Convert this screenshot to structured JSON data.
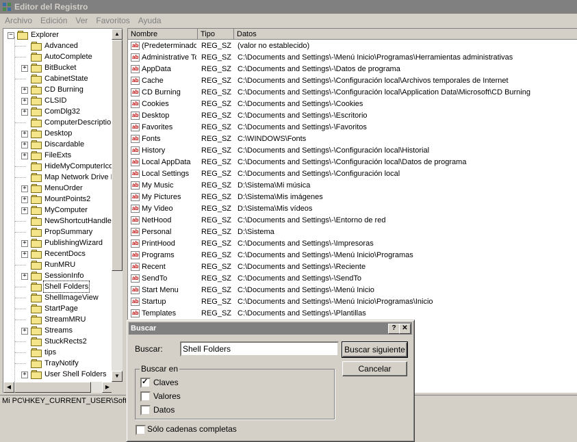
{
  "window": {
    "title": "Editor del Registro"
  },
  "menu": [
    "Archivo",
    "Edición",
    "Ver",
    "Favoritos",
    "Ayuda"
  ],
  "tree": {
    "items": [
      {
        "label": "Explorer",
        "expander": "−",
        "level": 0
      },
      {
        "label": "Advanced",
        "expander": "",
        "level": 1
      },
      {
        "label": "AutoComplete",
        "expander": "",
        "level": 1
      },
      {
        "label": "BitBucket",
        "expander": "+",
        "level": 1
      },
      {
        "label": "CabinetState",
        "expander": "",
        "level": 1
      },
      {
        "label": "CD Burning",
        "expander": "+",
        "level": 1
      },
      {
        "label": "CLSID",
        "expander": "+",
        "level": 1
      },
      {
        "label": "ComDlg32",
        "expander": "+",
        "level": 1
      },
      {
        "label": "ComputerDescriptions",
        "expander": "",
        "level": 1
      },
      {
        "label": "Desktop",
        "expander": "+",
        "level": 1
      },
      {
        "label": "Discardable",
        "expander": "+",
        "level": 1
      },
      {
        "label": "FileExts",
        "expander": "+",
        "level": 1
      },
      {
        "label": "HideMyComputerIcons",
        "expander": "",
        "level": 1
      },
      {
        "label": "Map Network Drive MRU",
        "expander": "",
        "level": 1
      },
      {
        "label": "MenuOrder",
        "expander": "+",
        "level": 1
      },
      {
        "label": "MountPoints2",
        "expander": "+",
        "level": 1
      },
      {
        "label": "MyComputer",
        "expander": "+",
        "level": 1
      },
      {
        "label": "NewShortcutHandlers",
        "expander": "",
        "level": 1
      },
      {
        "label": "PropSummary",
        "expander": "",
        "level": 1
      },
      {
        "label": "PublishingWizard",
        "expander": "+",
        "level": 1
      },
      {
        "label": "RecentDocs",
        "expander": "+",
        "level": 1
      },
      {
        "label": "RunMRU",
        "expander": "",
        "level": 1
      },
      {
        "label": "SessionInfo",
        "expander": "+",
        "level": 1
      },
      {
        "label": "Shell Folders",
        "expander": "",
        "level": 1,
        "selected": true
      },
      {
        "label": "ShellImageView",
        "expander": "",
        "level": 1
      },
      {
        "label": "StartPage",
        "expander": "",
        "level": 1
      },
      {
        "label": "StreamMRU",
        "expander": "",
        "level": 1
      },
      {
        "label": "Streams",
        "expander": "+",
        "level": 1
      },
      {
        "label": "StuckRects2",
        "expander": "",
        "level": 1
      },
      {
        "label": "tips",
        "expander": "",
        "level": 1
      },
      {
        "label": "TrayNotify",
        "expander": "",
        "level": 1
      },
      {
        "label": "User Shell Folders",
        "expander": "+",
        "level": 1
      }
    ]
  },
  "list": {
    "headers": [
      "Nombre",
      "Tipo",
      "Datos"
    ],
    "rows": [
      {
        "name": "(Predeterminado)",
        "type": "REG_SZ",
        "data": "(valor no establecido)"
      },
      {
        "name": "Administrative Tools",
        "type": "REG_SZ",
        "data": "C:\\Documents and Settings\\-\\Menú Inicio\\Programas\\Herramientas administrativas"
      },
      {
        "name": "AppData",
        "type": "REG_SZ",
        "data": "C:\\Documents and Settings\\-\\Datos de programa"
      },
      {
        "name": "Cache",
        "type": "REG_SZ",
        "data": "C:\\Documents and Settings\\-\\Configuración local\\Archivos temporales de Internet"
      },
      {
        "name": "CD Burning",
        "type": "REG_SZ",
        "data": "C:\\Documents and Settings\\-\\Configuración local\\Application Data\\Microsoft\\CD Burning"
      },
      {
        "name": "Cookies",
        "type": "REG_SZ",
        "data": "C:\\Documents and Settings\\-\\Cookies"
      },
      {
        "name": "Desktop",
        "type": "REG_SZ",
        "data": "C:\\Documents and Settings\\-\\Escritorio"
      },
      {
        "name": "Favorites",
        "type": "REG_SZ",
        "data": "C:\\Documents and Settings\\-\\Favoritos"
      },
      {
        "name": "Fonts",
        "type": "REG_SZ",
        "data": "C:\\WINDOWS\\Fonts"
      },
      {
        "name": "History",
        "type": "REG_SZ",
        "data": "C:\\Documents and Settings\\-\\Configuración local\\Historial"
      },
      {
        "name": "Local AppData",
        "type": "REG_SZ",
        "data": "C:\\Documents and Settings\\-\\Configuración local\\Datos de programa"
      },
      {
        "name": "Local Settings",
        "type": "REG_SZ",
        "data": "C:\\Documents and Settings\\-\\Configuración local"
      },
      {
        "name": "My Music",
        "type": "REG_SZ",
        "data": "D:\\Sistema\\Mi música"
      },
      {
        "name": "My Pictures",
        "type": "REG_SZ",
        "data": "D:\\Sistema\\Mis imágenes"
      },
      {
        "name": "My Video",
        "type": "REG_SZ",
        "data": "D:\\Sistema\\Mis vídeos"
      },
      {
        "name": "NetHood",
        "type": "REG_SZ",
        "data": "C:\\Documents and Settings\\-\\Entorno de red"
      },
      {
        "name": "Personal",
        "type": "REG_SZ",
        "data": "D:\\Sistema"
      },
      {
        "name": "PrintHood",
        "type": "REG_SZ",
        "data": "C:\\Documents and Settings\\-\\Impresoras"
      },
      {
        "name": "Programs",
        "type": "REG_SZ",
        "data": "C:\\Documents and Settings\\-\\Menú Inicio\\Programas"
      },
      {
        "name": "Recent",
        "type": "REG_SZ",
        "data": "C:\\Documents and Settings\\-\\Reciente"
      },
      {
        "name": "SendTo",
        "type": "REG_SZ",
        "data": "C:\\Documents and Settings\\-\\SendTo"
      },
      {
        "name": "Start Menu",
        "type": "REG_SZ",
        "data": "C:\\Documents and Settings\\-\\Menú Inicio"
      },
      {
        "name": "Startup",
        "type": "REG_SZ",
        "data": "C:\\Documents and Settings\\-\\Menú Inicio\\Programas\\Inicio"
      },
      {
        "name": "Templates",
        "type": "REG_SZ",
        "data": "C:\\Documents and Settings\\-\\Plantillas"
      }
    ]
  },
  "status": {
    "path": "Mi PC\\HKEY_CURRENT_USER\\Software\\Microsoft\\Windows\\CurrentVersion\\Explorer\\Shell Folders"
  },
  "dialog": {
    "title": "Buscar",
    "help_glyph": "?",
    "close_glyph": "✕",
    "search_label": "Buscar:",
    "search_value": "Shell Folders",
    "find_next": "Buscar siguiente",
    "cancel": "Cancelar",
    "group_title": "Buscar en",
    "options": [
      {
        "label": "Claves",
        "checked": true
      },
      {
        "label": "Valores",
        "checked": false
      },
      {
        "label": "Datos",
        "checked": false
      }
    ],
    "whole_string": {
      "label": "Sólo cadenas completas",
      "checked": false
    }
  }
}
